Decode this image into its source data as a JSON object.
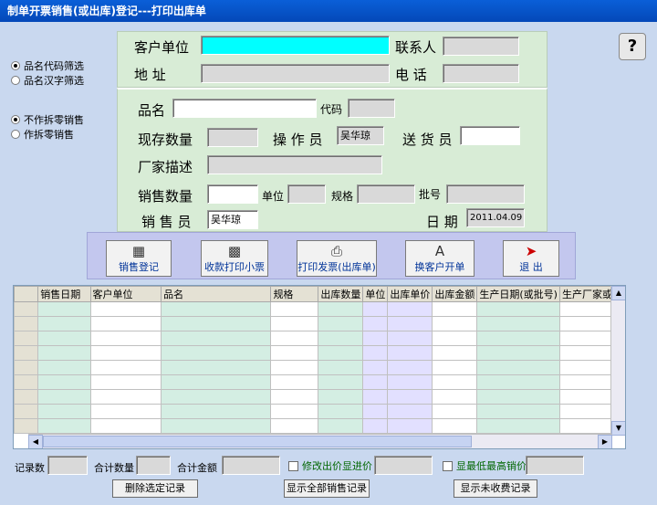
{
  "window": {
    "title": "制单开票销售(或出库)登记---打印出库单"
  },
  "filter": {
    "opt_code": "品名代码筛选",
    "opt_name": "品名汉字筛选"
  },
  "retail": {
    "opt_no": "不作拆零销售",
    "opt_yes": "作拆零销售"
  },
  "customer": {
    "unit_label": "客户单位",
    "contact_label": "联系人",
    "address_label": "地 址",
    "phone_label": "电 话"
  },
  "product": {
    "name_label": "品名",
    "code_label": "代码",
    "stock_label": "现存数量",
    "operator_label": "操 作 员",
    "operator_value": "吴华琼",
    "deliverer_label": "送 货 员",
    "maker_label": "厂家描述",
    "qty_label": "销售数量",
    "unit_label": "单位",
    "spec_label": "规格",
    "batch_label": "批号",
    "seller_label": "销 售 员",
    "seller_value": "吴华琼",
    "date_label": "日 期",
    "date_value": "2011.04.09"
  },
  "toolbar": {
    "register": "销售登记",
    "receipt": "收款打印小票",
    "invoice": "打印发票(出库单)",
    "switch": "换客户开单",
    "exit": "退 出"
  },
  "grid": {
    "columns": [
      "销售日期",
      "客户单位",
      "品名",
      "规格",
      "出库数量",
      "单位",
      "出库单价",
      "出库金额",
      "生产日期(或批号)",
      "生产厂家或描"
    ],
    "row_count": 9
  },
  "footer": {
    "record_count": "记录数",
    "total_qty": "合计数量",
    "total_amount": "合计金额",
    "modify_price": "修改出价显进价",
    "show_minmax": "显最低最高销价",
    "delete_btn": "删除选定记录",
    "show_all_btn": "显示全部销售记录",
    "show_unpaid_btn": "显示未收费记录"
  }
}
